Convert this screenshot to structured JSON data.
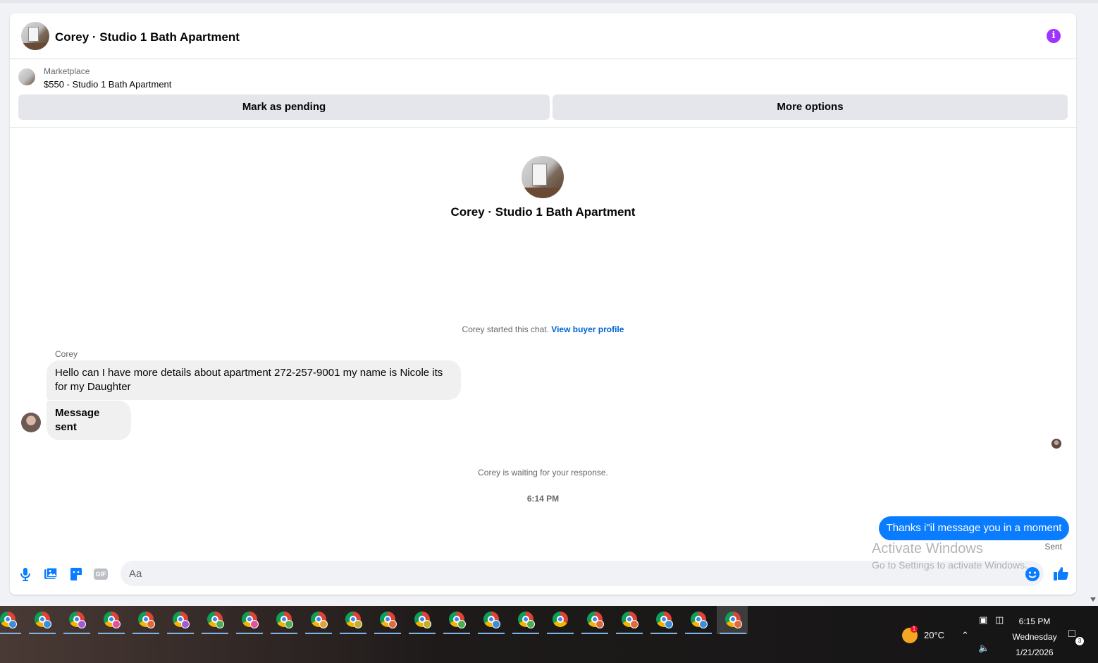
{
  "conversation": {
    "title": "Corey · Studio 1 Bath Apartment"
  },
  "listing": {
    "source": "Marketplace",
    "price_title": "$550 - Studio 1 Bath Apartment",
    "mark_pending_label": "Mark as pending",
    "more_options_label": "More options"
  },
  "profile": {
    "name": "Corey · Studio 1 Bath Apartment"
  },
  "thread": {
    "started_text": "Corey started this chat.",
    "view_profile_label": "View buyer profile",
    "sender_name": "Corey",
    "incoming": [
      "Hello can I have more details about apartment  272-257-9001 my name is Nicole its for my Daughter",
      "Message sent"
    ],
    "waiting_text": "Corey is waiting for your response.",
    "time_separator": "6:14 PM",
    "outgoing": "Thanks i\"il message you in a moment",
    "sent_label": "Sent"
  },
  "composer": {
    "placeholder": "Aa",
    "gif_label": "GIF"
  },
  "watermark": {
    "title": "Activate Windows",
    "subtitle": "Go to Settings to activate Windows."
  },
  "taskbar": {
    "weather_badge": "1",
    "temperature": "20°C",
    "time": "6:15 PM",
    "day": "Wednesday",
    "date": "1/21/2026",
    "notification_count": "3",
    "app_badge_colors": [
      "#3b8fd9",
      "#3b8fd9",
      "#a05cd6",
      "#e0539a",
      "#e06a3b",
      "#a05cd6",
      "#4cae4f",
      "#e0539a",
      "#4cae4f",
      "#e0a33b",
      "#c0b030",
      "#e06a3b",
      "#c0b030",
      "#4cae4f",
      "#3b8fd9",
      "#4cae4f",
      "",
      "#e06a3b",
      "#e06a3b",
      "#3b8fd9",
      "#3b8fd9",
      "#e06a3b"
    ]
  },
  "colors": {
    "accent": "#0a7cff",
    "info": "#a033ff",
    "link": "#0064d1"
  }
}
